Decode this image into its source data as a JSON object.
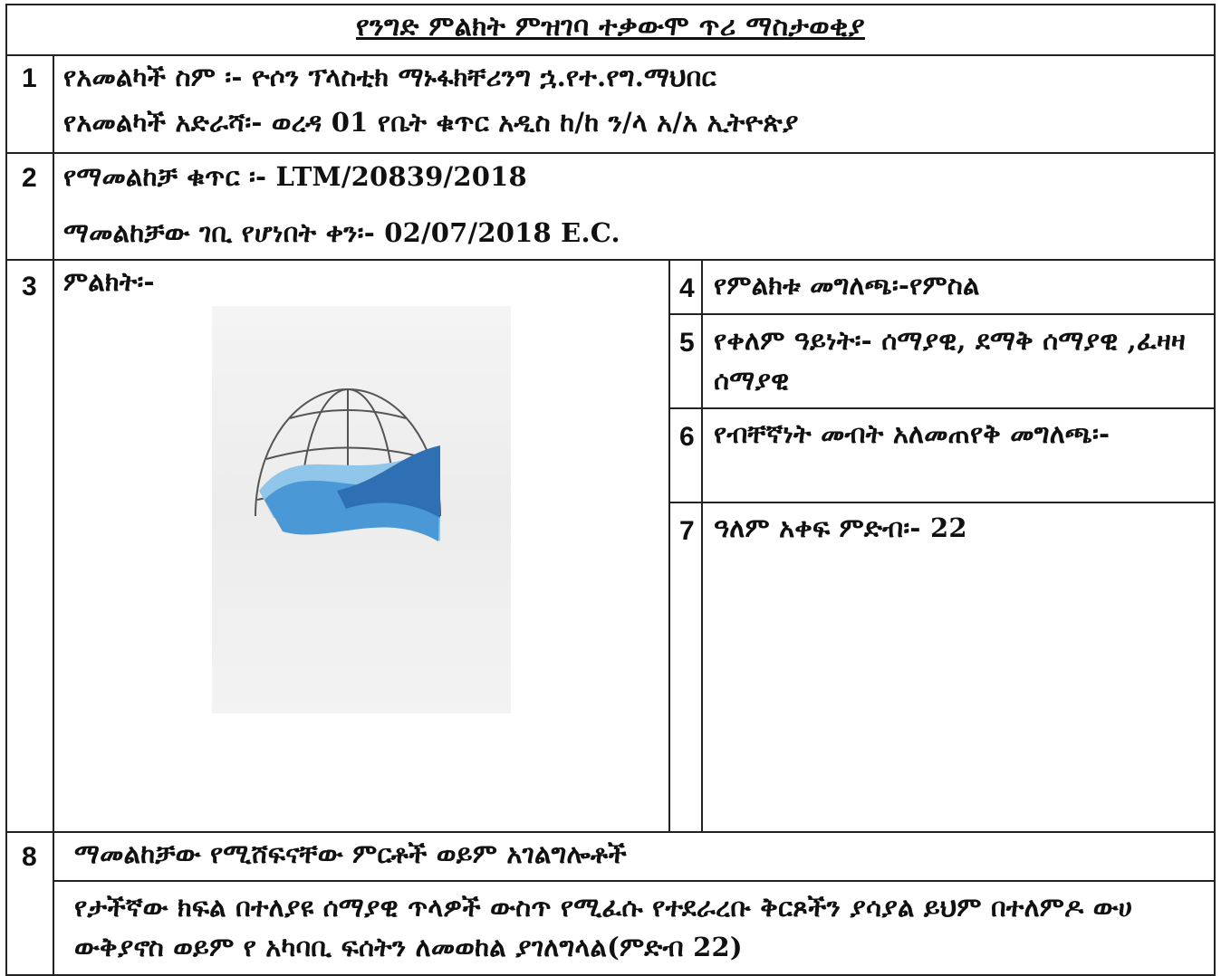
{
  "title": "የንግድ ምልክት ምዝገባ ተቃውሞ ጥሪ ማስታወቂያ",
  "rows": {
    "r1": {
      "num": "1",
      "applicant_name": "የአመልካች ስም ፡- ዮሶን ፕላስቲክ ማኑፋክቸሪንግ ኋ.የተ.የግ.ማህበር",
      "applicant_address": "የአመልካች አድራሻ፡- ወረዳ 01 የቤት ቁጥር አዲስ ከ/ከ ን/ላ አ/አ ኢትዮጵያ"
    },
    "r2": {
      "num": "2",
      "application_number": "የማመልከቻ ቁጥር ፡- LTM/20839/2018",
      "filing_date": "ማመልከቻው ገቢ የሆነበት ቀን፡- 02/07/2018 E.C."
    },
    "r3": {
      "num": "3",
      "label": "ምልክት፡-"
    },
    "r4": {
      "num": "4",
      "label": "የምልክቱ መግለጫ፡-የምስል"
    },
    "r5": {
      "num": "5",
      "label": "የቀለም ዓይነት፡- ሰማያዊ, ደማቅ ሰማያዊ ,ፈዛዛ ሰማያዊ"
    },
    "r6": {
      "num": "6",
      "label": "የብቸኛነት መብት አለመጠየቅ መግለጫ፡-"
    },
    "r7": {
      "num": "7",
      "label": "ዓለም አቀፍ ምድብ፡- 22"
    },
    "r8": {
      "num": "8",
      "heading": "ማመልከቻው የሚሸፍናቸው ምርቶች ወይም አገልግሎቶች",
      "body": "የታችኛው ክፍል በተለያዩ ሰማያዊ ጥላዎች ውስጥ የሚፈሱ የተደራረቡ ቅርጾችን ያሳያል ይህም በተለምዶ ውሀ ውቅያኖስ ወይም የ አካባቢ ፍሰትን ለመወከል ያገለግላል(ምድብ 22)"
    }
  },
  "colors": {
    "wave_dark": "#2f6fb3",
    "wave_mid": "#4a98d6",
    "wave_light": "#8fc6ea",
    "globe_grid": "#555555"
  }
}
